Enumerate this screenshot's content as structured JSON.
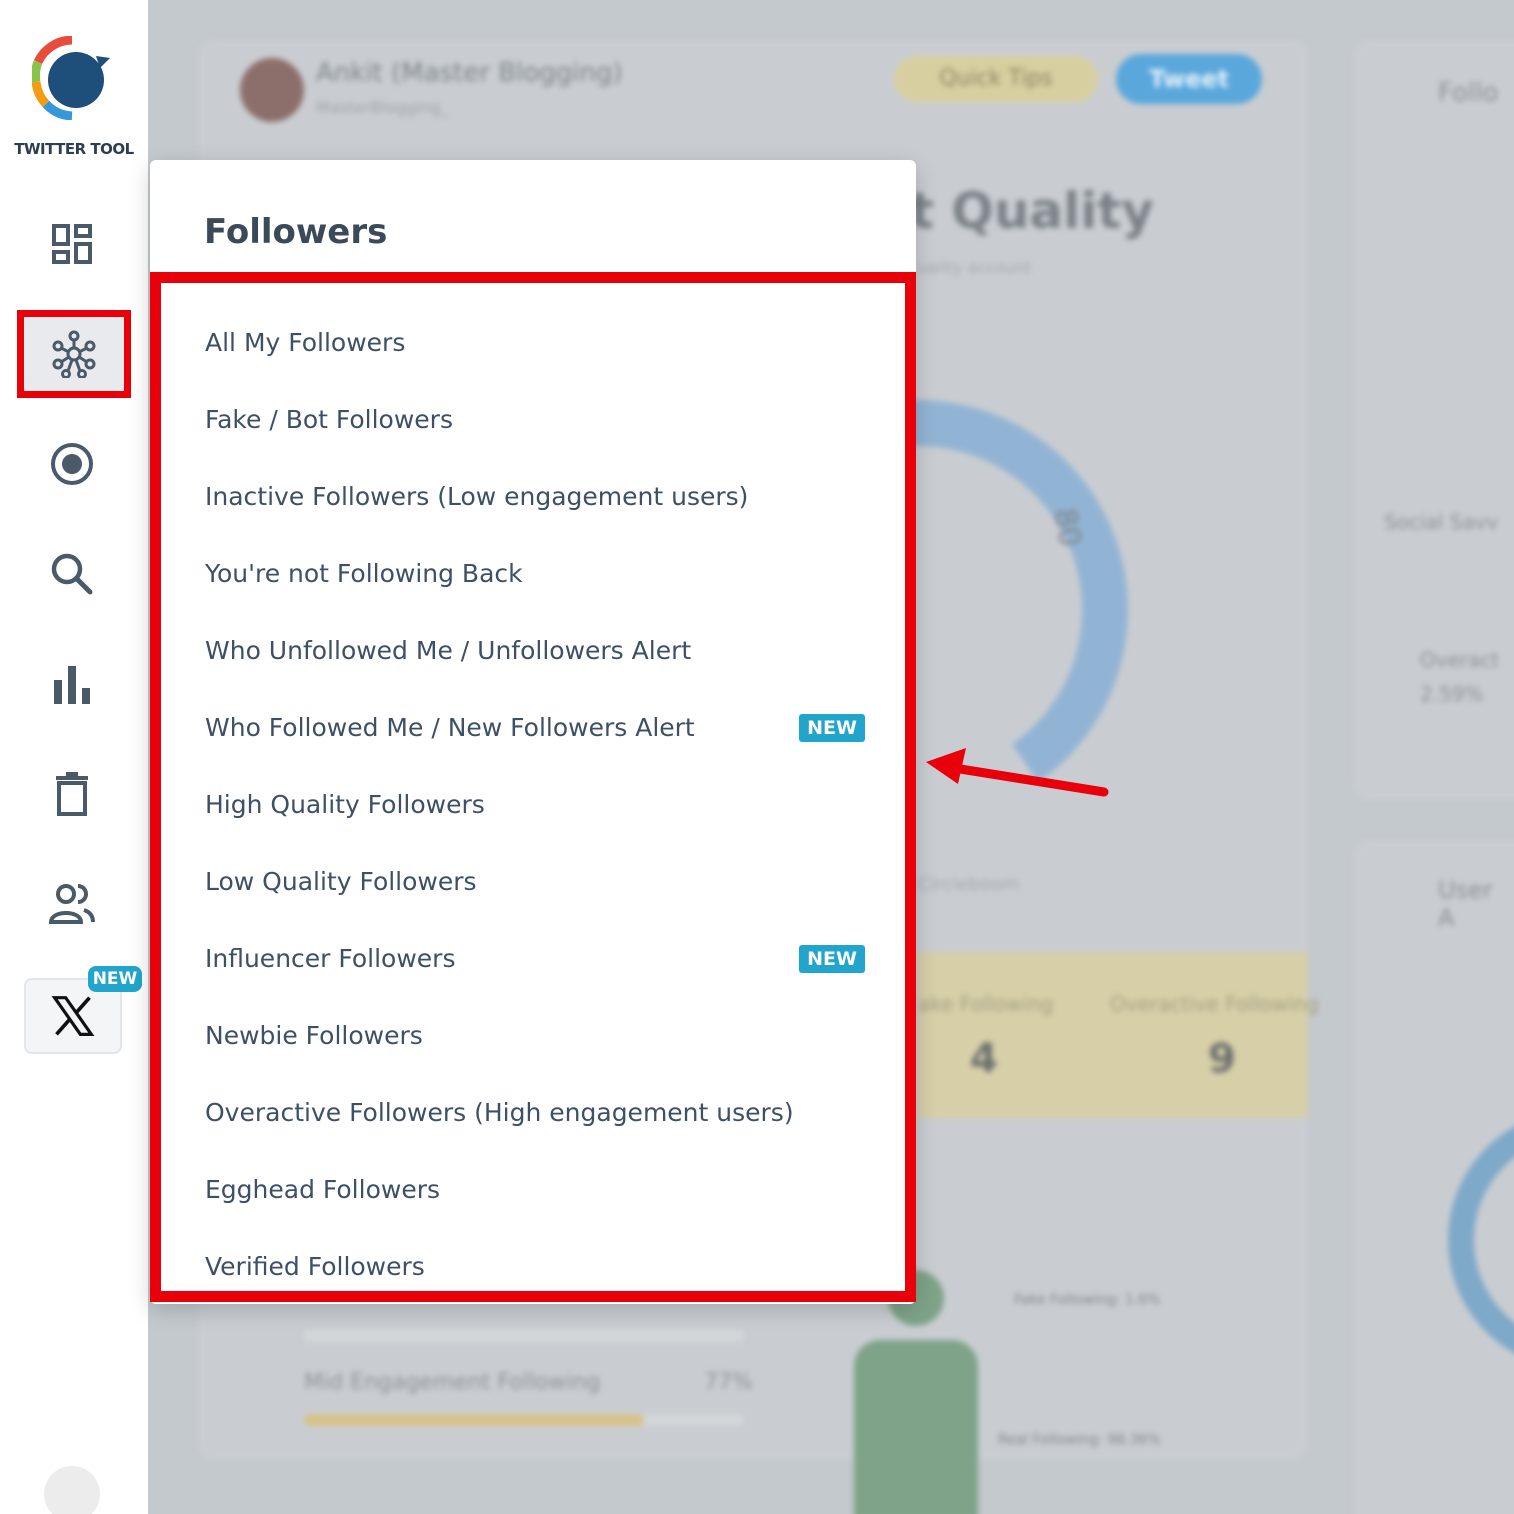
{
  "app": {
    "logo_text": "TWITTER TOOL",
    "x_badge": "NEW"
  },
  "sidebar": {
    "items": [
      {
        "name": "dashboard",
        "icon": "dashboard-icon"
      },
      {
        "name": "followers",
        "icon": "network-hub-icon",
        "active": true
      },
      {
        "name": "monitor",
        "icon": "radio-target-icon"
      },
      {
        "name": "search",
        "icon": "search-icon"
      },
      {
        "name": "analytics",
        "icon": "bar-chart-icon"
      },
      {
        "name": "delete",
        "icon": "trash-icon"
      },
      {
        "name": "users",
        "icon": "users-icon"
      },
      {
        "name": "x",
        "icon": "x-logo-icon"
      }
    ]
  },
  "panel": {
    "title": "Followers",
    "items": [
      {
        "label": "All My Followers",
        "badge": ""
      },
      {
        "label": "Fake / Bot Followers",
        "badge": ""
      },
      {
        "label": "Inactive Followers (Low engagement users)",
        "badge": ""
      },
      {
        "label": "You're not Following Back",
        "badge": ""
      },
      {
        "label": "Who Unfollowed Me / Unfollowers Alert",
        "badge": ""
      },
      {
        "label": "Who Followed Me / New Followers Alert",
        "badge": "NEW"
      },
      {
        "label": "High Quality Followers",
        "badge": ""
      },
      {
        "label": "Low Quality Followers",
        "badge": ""
      },
      {
        "label": "Influencer Followers",
        "badge": "NEW"
      },
      {
        "label": "Newbie Followers",
        "badge": ""
      },
      {
        "label": "Overactive Followers (High engagement users)",
        "badge": ""
      },
      {
        "label": "Egghead Followers",
        "badge": ""
      },
      {
        "label": "Verified Followers",
        "badge": ""
      }
    ]
  },
  "background": {
    "user_name": "Ankit (Master Blogging)",
    "user_handle": "MasterBlogging_",
    "quick_tips": "Quick Tips",
    "tweet": "Tweet",
    "heading": "t Quality",
    "subheading": "uality account",
    "gauge_label": "80",
    "circle_label": "Circleboom",
    "yellow_label_1": "ake Following",
    "yellow_label_2": "Overactive Following",
    "yellow_value_1": "4",
    "yellow_value_2": "9",
    "mid_engagement": "Mid Engagement Following",
    "mid_engagement_pct": "77%",
    "fake_following": "Fake Following: 1.6%",
    "real_following": "Real Following: 98.36%",
    "right_card_1": "Follo",
    "right_card_2": "Social Savv",
    "right_card_3": "Overact",
    "right_card_4": "2.59%",
    "right_card_5": "User A"
  },
  "colors": {
    "highlight": "#e8000b",
    "badge": "#22a5cc",
    "text": "#3d5066"
  }
}
